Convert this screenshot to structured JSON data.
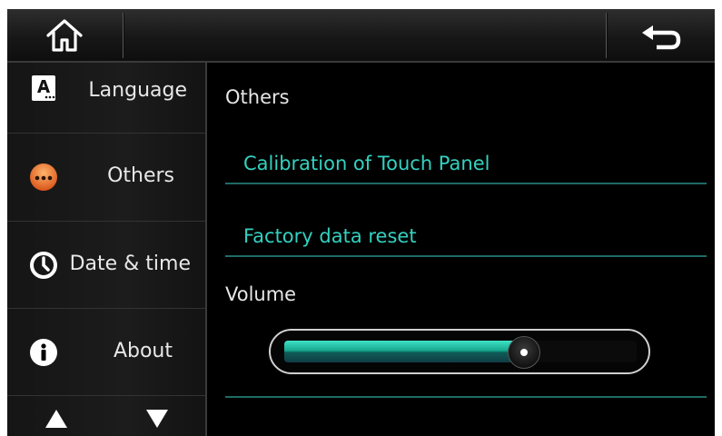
{
  "header": {
    "home_icon": "home-icon",
    "back_icon": "back-arrow-icon"
  },
  "sidebar": {
    "items": [
      {
        "label": "Language",
        "icon": "language-icon"
      },
      {
        "label": "Others",
        "icon": "others-icon"
      },
      {
        "label": "Date & time",
        "icon": "clock-icon"
      },
      {
        "label": "About",
        "icon": "info-icon"
      }
    ],
    "nav": {
      "up_icon": "arrow-up-icon",
      "down_icon": "arrow-down-icon"
    }
  },
  "main": {
    "title": "Others",
    "links": [
      {
        "label": "Calibration of Touch Panel"
      },
      {
        "label": "Factory data reset"
      }
    ],
    "volume": {
      "label": "Volume",
      "level": 0.68
    }
  },
  "colors": {
    "accent": "#33d1c0",
    "divider": "#1e6b66",
    "background": "#000000"
  }
}
